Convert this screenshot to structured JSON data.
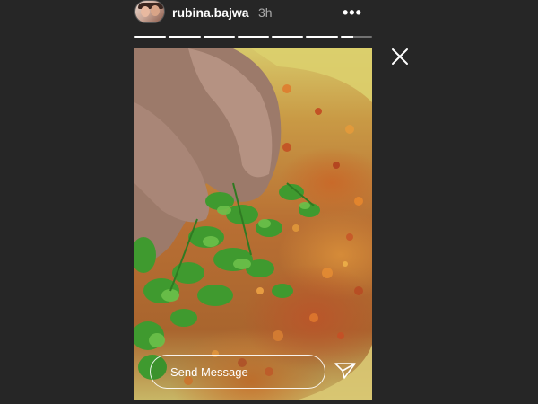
{
  "header": {
    "username": "rubina.bajwa",
    "time": "3h",
    "more_label": "•••"
  },
  "story": {
    "segments": 7,
    "current_index": 6,
    "current_progress": 0.4,
    "description_icon": "food-photo"
  },
  "composer": {
    "placeholder": "Send Message"
  },
  "icons": {
    "close": "close-icon",
    "send": "paper-plane-icon",
    "more": "ellipsis-icon"
  },
  "colors": {
    "background": "#262626",
    "text": "#ffffff",
    "muted": "#aaaaaa"
  }
}
